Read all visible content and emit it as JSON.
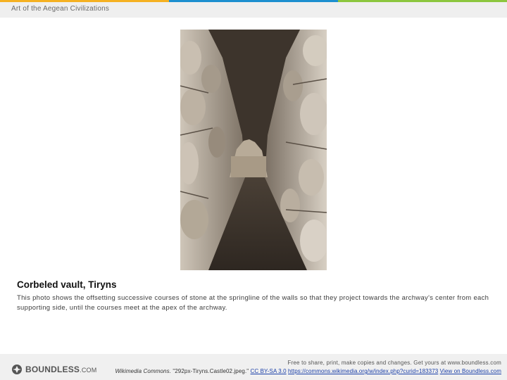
{
  "colors": {
    "top_bar": [
      "#f5b122",
      "#1d8fcf",
      "#8cc63e"
    ],
    "header_bg": "#efefef",
    "footer_bg": "#f0f0f0",
    "link": "#1a3fa8"
  },
  "header": {
    "title": "Art of the Aegean Civilizations"
  },
  "figure": {
    "image_icon": "stone-corridor-photo",
    "title": "Corbeled vault, Tiryns",
    "description": "This photo shows the offsetting successive courses of stone at the springline of the walls so that they project towards the archway's center from each supporting side, until the courses meet at the apex of the archway."
  },
  "footer": {
    "logo_text": "BOUNDLESS",
    "logo_suffix": ".COM",
    "line1": "Free to share, print, make copies and changes. Get yours at www.boundless.com",
    "attribution_source": "Wikimedia Commons.",
    "attribution_file": " \"292px-Tiryns.Castle02.jpeg.\" ",
    "license_link": "CC BY-SA 3.0",
    "url_link": "https://commons.wikimedia.org/w/index.php?curid=183373",
    "view_link": "View on Boundless.com"
  }
}
